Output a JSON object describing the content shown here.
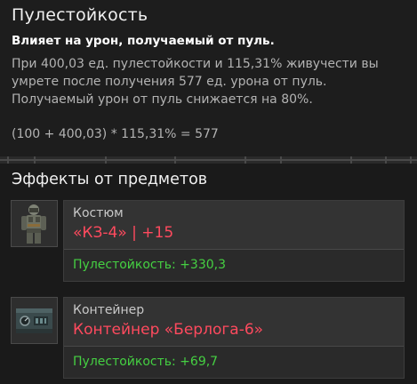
{
  "stat": {
    "title": "Пулестойкость",
    "subtitle": "Влияет на урон, получаемый от пуль.",
    "description_lines": [
      "При 400,03 ед. пулестойкости и 115,31% живучести вы",
      "умрете после получения 577 ед. урона от пуль.",
      "Получаемый урон от пуль снижается на 80%."
    ],
    "formula": "(100 + 400,03) * 115,31% = 577"
  },
  "effects": {
    "title": "Эффекты от предметов",
    "items": [
      {
        "category": "Костюм",
        "name": "«КЗ-4» | +15",
        "stat": "Пулестойкость: +330,3",
        "icon": "armor-suit-icon"
      },
      {
        "category": "Контейнер",
        "name": "Контейнер «Берлога-6»",
        "stat": "Пулестойкость: +69,7",
        "icon": "artifact-container-icon"
      }
    ]
  },
  "colors": {
    "item_name": "#ff4a5e",
    "stat_bonus": "#45d042",
    "background": "#1a1a1a"
  }
}
